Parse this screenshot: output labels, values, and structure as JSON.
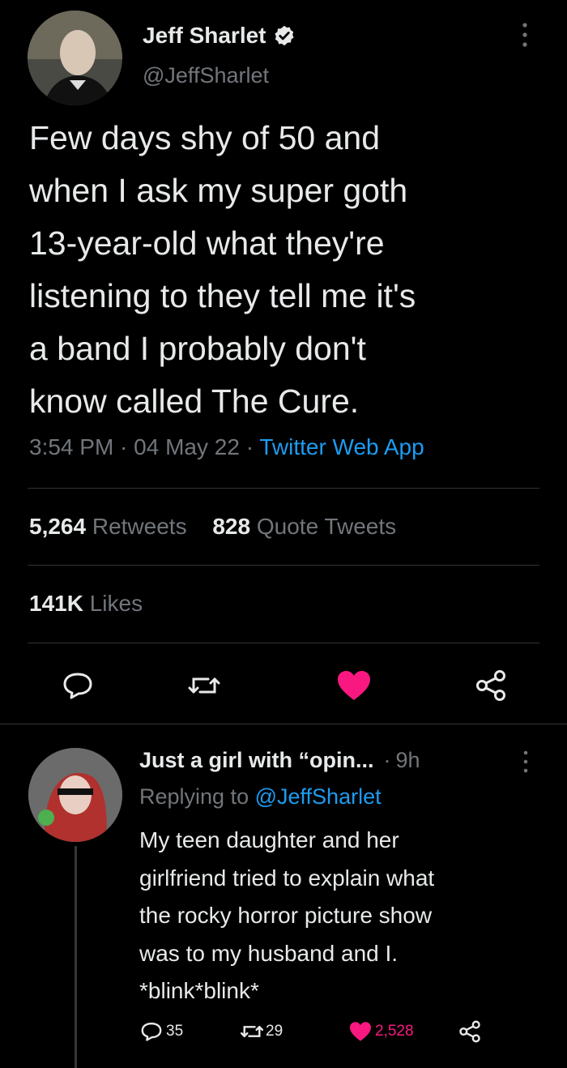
{
  "tweet": {
    "author_name": "Jeff Sharlet",
    "author_handle": "@JeffSharlet",
    "text_lines": [
      "Few days shy of 50 and",
      "when I ask my super goth",
      "13-year-old what they're",
      "listening to they tell me it's",
      "a band I probably don't",
      "know called The Cure."
    ],
    "time": "3:54 PM",
    "date": "04 May 22",
    "source": "Twitter Web App",
    "retweets_count": "5,264",
    "retweets_label": "Retweets",
    "quotes_count": "828",
    "quotes_label": "Quote Tweets",
    "likes_count": "141K",
    "likes_label": "Likes"
  },
  "reply": {
    "author_name": "Just a girl with “opin...",
    "age": "9h",
    "replying_prefix": "Replying to",
    "replying_handle": "@JeffSharlet",
    "text_lines": [
      "My teen daughter and her",
      "girlfriend tried to explain what",
      "the rocky horror picture show",
      "was to my husband and I.",
      "*blink*blink*"
    ],
    "replies_count": "35",
    "retweets_count": "29",
    "likes_count": "2,528"
  },
  "icons": {
    "verified": "verified-badge-icon",
    "more": "more-vertical-icon",
    "reply": "reply-icon",
    "retweet": "retweet-icon",
    "like": "heart-icon",
    "share": "share-icon"
  },
  "colors": {
    "background": "#000000",
    "text": "#e7e9ea",
    "muted": "#71767b",
    "link": "#1d9bf0",
    "like": "#f91880"
  }
}
